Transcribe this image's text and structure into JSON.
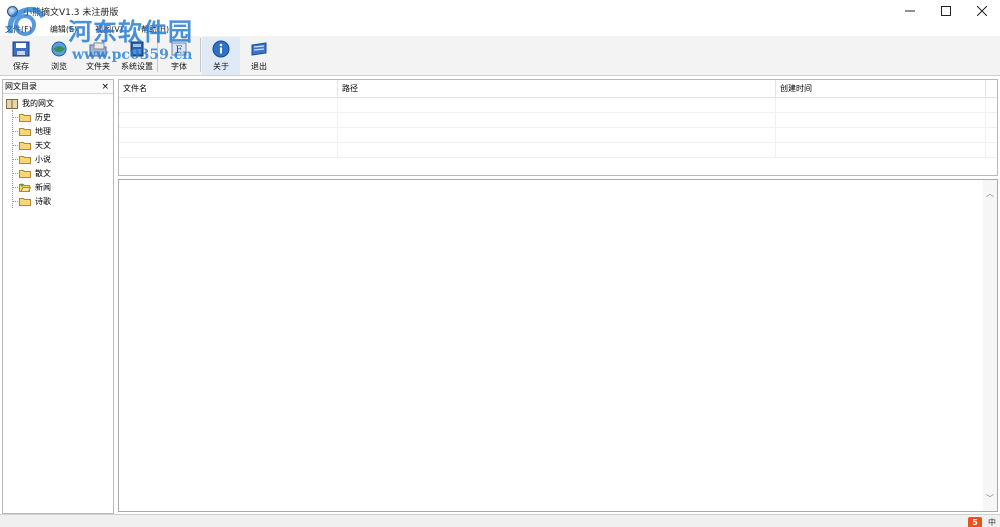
{
  "window": {
    "title": "小熊摘文V1.3 未注册版",
    "controls": [
      "minimize",
      "maximize",
      "close"
    ]
  },
  "menu": {
    "items": [
      "文件(F)",
      "编辑(E)",
      "视图(V)",
      "帮助(H)"
    ]
  },
  "watermark": {
    "title": "河东软件园",
    "url": "www.pc0359.cn"
  },
  "toolbar": {
    "buttons": [
      {
        "label": "保存",
        "icon": "save-icon"
      },
      {
        "label": "浏览",
        "icon": "browse-icon"
      },
      {
        "label": "文件夹",
        "icon": "folder-icon"
      },
      {
        "label": "系统设置",
        "icon": "settings-icon"
      },
      {
        "label": "字体",
        "icon": "font-icon"
      },
      {
        "label": "关于",
        "icon": "info-icon"
      },
      {
        "label": "退出",
        "icon": "exit-icon"
      }
    ]
  },
  "left_panel": {
    "title": "网文目录",
    "close_label": "×",
    "root": "我的网文",
    "categories": [
      "历史",
      "地理",
      "天文",
      "小说",
      "散文",
      "新闻",
      "诗歌"
    ]
  },
  "file_list": {
    "columns": [
      "文件名",
      "路径",
      "创建时间"
    ]
  },
  "content": {
    "scroll_up": "︿",
    "scroll_down": "﹀"
  },
  "statusbar": {
    "tray_logo": "5",
    "tray_ime": "中"
  }
}
